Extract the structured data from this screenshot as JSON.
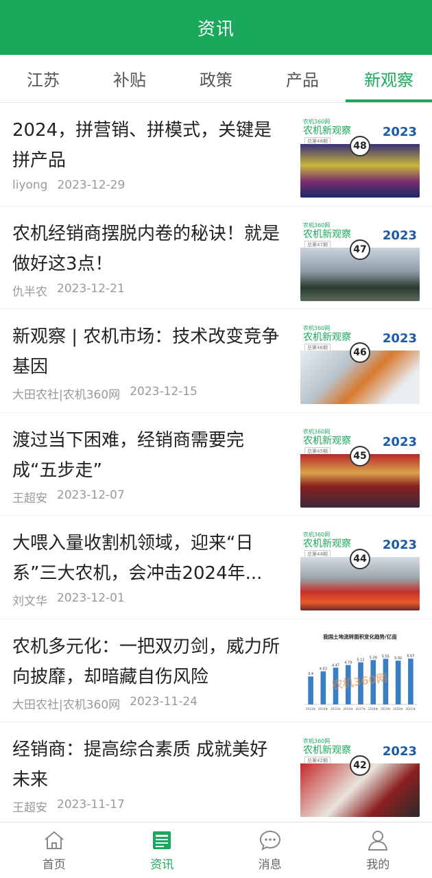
{
  "header": {
    "title": "资讯"
  },
  "tabs": [
    {
      "label": "江苏",
      "active": false
    },
    {
      "label": "补贴",
      "active": false
    },
    {
      "label": "政策",
      "active": false
    },
    {
      "label": "产品",
      "active": false
    },
    {
      "label": "新观察",
      "active": true
    }
  ],
  "thumb_common": {
    "brand": "农机360网",
    "label": "农机新观察",
    "year": "2023"
  },
  "articles": [
    {
      "title": "2024，拼营销、拼模式，关键是拼产品",
      "author": "liyong",
      "date": "2023-12-29",
      "issue": "48",
      "issue_tag": "总第48期"
    },
    {
      "title": "农机经销商摆脱内卷的秘诀！就是做好这3点！",
      "author": "仇半农",
      "date": "2023-12-21",
      "issue": "47",
      "issue_tag": "总第47期"
    },
    {
      "title": "新观察 | 农机市场：技术改变竞争基因",
      "author": "大田农社|农机360网",
      "date": "2023-12-15",
      "issue": "46",
      "issue_tag": "总第46期"
    },
    {
      "title": "渡过当下困难，经销商需要完成“五步走”",
      "author": "王超安",
      "date": "2023-12-07",
      "issue": "45",
      "issue_tag": "总第45期"
    },
    {
      "title": "大喂入量收割机领域，迎来“日系”三大农机，会冲击2024年...",
      "author": "刘文华",
      "date": "2023-12-01",
      "issue": "44",
      "issue_tag": "总第44期"
    },
    {
      "title": "农机多元化：一把双刃剑，威力所向披靡，却暗藏自伤风险",
      "author": "大田农社|农机360网",
      "date": "2023-11-24",
      "issue": "",
      "issue_tag": ""
    },
    {
      "title": " 经销商：提高综合素质 成就美好未来",
      "author": "王超安",
      "date": "2023-11-17",
      "issue": "42",
      "issue_tag": "总第42期"
    }
  ],
  "chart_data": {
    "type": "bar",
    "title": "我国土地流转面积变化趋势",
    "unit": "亿亩",
    "categories": [
      "2013年",
      "2014年",
      "2015年",
      "2016年",
      "2017年",
      "2018年",
      "2019年",
      "2020年",
      "2021年"
    ],
    "values": [
      3.4,
      4.03,
      4.47,
      4.79,
      5.12,
      5.39,
      5.55,
      5.32,
      5.57
    ],
    "watermark": "农机360网",
    "color": "#3a7fc4"
  },
  "bottom_nav": [
    {
      "label": "首页",
      "icon": "home-icon",
      "active": false
    },
    {
      "label": "资讯",
      "icon": "news-icon",
      "active": true
    },
    {
      "label": "消息",
      "icon": "message-icon",
      "active": false
    },
    {
      "label": "我的",
      "icon": "profile-icon",
      "active": false
    }
  ],
  "colors": {
    "brand_green": "#1aa95c",
    "meta_gray": "#999999"
  }
}
